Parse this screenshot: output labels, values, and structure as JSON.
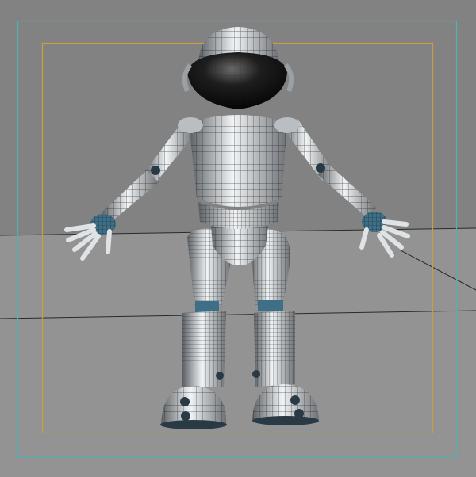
{
  "viewport": {
    "colors": {
      "background_upper": "#828282",
      "background_lower": "#939393",
      "grid_line": "#2a2a2a",
      "safe_frame_outer": "#4fb3b3",
      "safe_frame_inner": "#c9a040",
      "mesh_light": "#e8ecef",
      "mesh_dark": "#1a1a1a",
      "joint_blue": "#3d6f86"
    },
    "model": "robot-character-wireframe-shaded"
  }
}
